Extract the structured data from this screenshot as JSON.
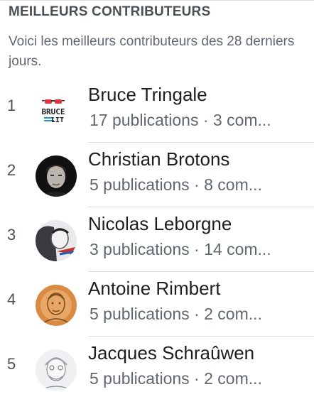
{
  "header": {
    "title": "MEILLEURS CONTRIBUTEURS",
    "subtitle": "Voici les meilleurs contributeurs des 28 derniers jours."
  },
  "contributors": [
    {
      "rank": "1",
      "name": "Bruce Tringale",
      "meta": "17 publications · 3 com...",
      "avatar_icon": "bruce-lit-logo-icon"
    },
    {
      "rank": "2",
      "name": "Christian Brotons",
      "meta": "5 publications · 8 com...",
      "avatar_icon": "user-avatar"
    },
    {
      "rank": "3",
      "name": "Nicolas Leborgne",
      "meta": "3 publications · 14 com...",
      "avatar_icon": "user-avatar"
    },
    {
      "rank": "4",
      "name": "Antoine Rimbert",
      "meta": "5 publications · 2 com...",
      "avatar_icon": "user-avatar"
    },
    {
      "rank": "5",
      "name": "Jacques Schraûwen",
      "meta": "5 publications · 2 com...",
      "avatar_icon": "user-avatar"
    }
  ],
  "avatar_logo_text": "BRUCE LIT"
}
